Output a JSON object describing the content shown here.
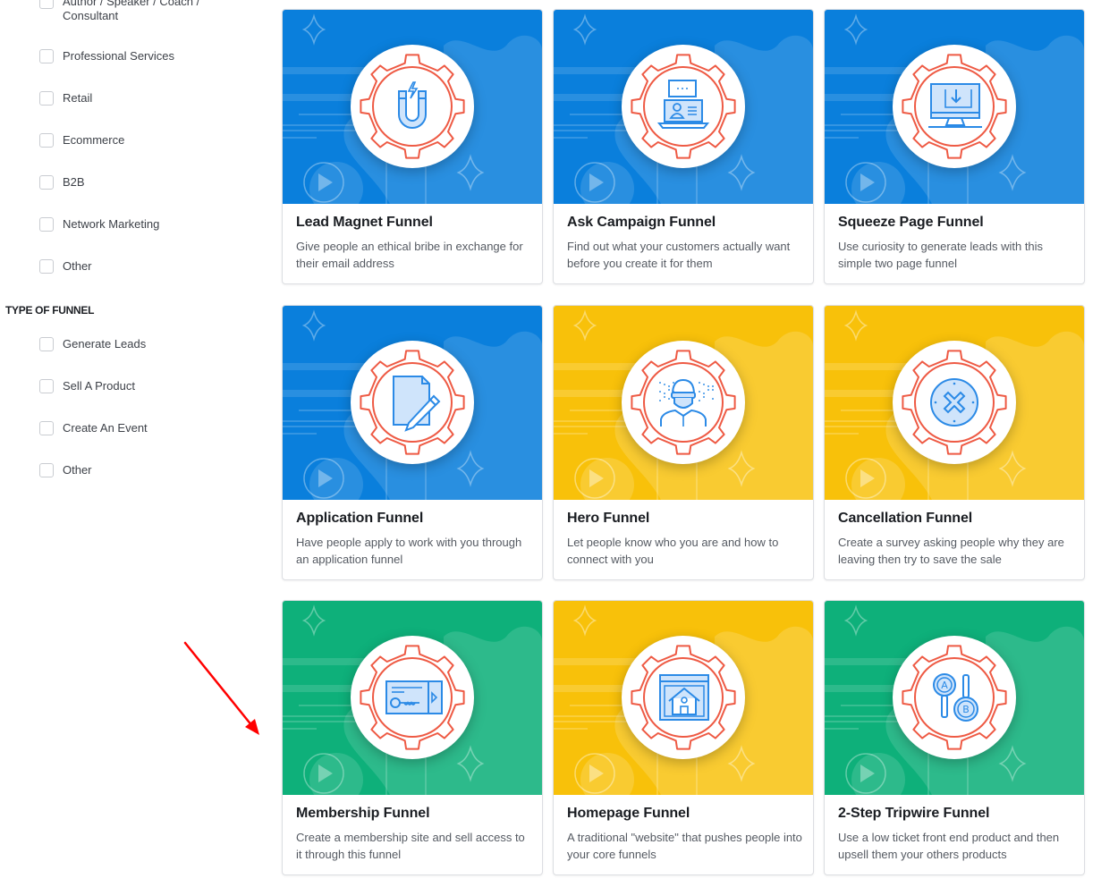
{
  "sidebar": {
    "industry_items": [
      {
        "label": "Author / Speaker / Coach / Consultant",
        "checked": false
      },
      {
        "label": "Professional Services",
        "checked": false
      },
      {
        "label": "Retail",
        "checked": false
      },
      {
        "label": "Ecommerce",
        "checked": false
      },
      {
        "label": "B2B",
        "checked": false
      },
      {
        "label": "Network Marketing",
        "checked": false
      },
      {
        "label": "Other",
        "checked": false
      }
    ],
    "type_section_title": "TYPE OF FUNNEL",
    "type_items": [
      {
        "label": "Generate Leads",
        "checked": false
      },
      {
        "label": "Sell A Product",
        "checked": false
      },
      {
        "label": "Create An Event",
        "checked": false
      },
      {
        "label": "Other",
        "checked": false
      }
    ]
  },
  "colors": {
    "blue": "#0a7fdc",
    "yellow": "#f8c10a",
    "green": "#0eb07a",
    "gear": "#ee5a44",
    "icon": "#2b8ae6",
    "annotation_arrow": "#ff0000"
  },
  "cards": [
    {
      "title": "Lead Magnet Funnel",
      "description": "Give people an ethical bribe in exchange for their email address",
      "theme": "blue",
      "icon": "magnet-icon"
    },
    {
      "title": "Ask Campaign Funnel",
      "description": "Find out what your customers actually want before you create it for them",
      "theme": "blue",
      "icon": "laptop-chat-icon"
    },
    {
      "title": "Squeeze Page Funnel",
      "description": "Use curiosity to generate leads with this simple two page funnel",
      "theme": "blue",
      "icon": "monitor-download-icon"
    },
    {
      "title": "Application Funnel",
      "description": "Have people apply to work with you through an application funnel",
      "theme": "blue",
      "icon": "document-pen-icon"
    },
    {
      "title": "Hero Funnel",
      "description": "Let people know who you are and how to connect with you",
      "theme": "yellow",
      "icon": "hero-person-icon"
    },
    {
      "title": "Cancellation Funnel",
      "description": "Create a survey asking people why they are leaving then try to save the sale",
      "theme": "yellow",
      "icon": "cancel-x-icon"
    },
    {
      "title": "Membership Funnel",
      "description": "Create a membership site and sell access to it through this funnel",
      "theme": "green",
      "icon": "keycard-icon"
    },
    {
      "title": "Homepage Funnel",
      "description": "A traditional \"website\" that pushes people into your core funnels",
      "theme": "yellow",
      "icon": "website-home-icon"
    },
    {
      "title": "2-Step Tripwire Funnel",
      "description": "Use a low ticket front end product and then upsell them your others products",
      "theme": "green",
      "icon": "ab-test-icon"
    }
  ]
}
